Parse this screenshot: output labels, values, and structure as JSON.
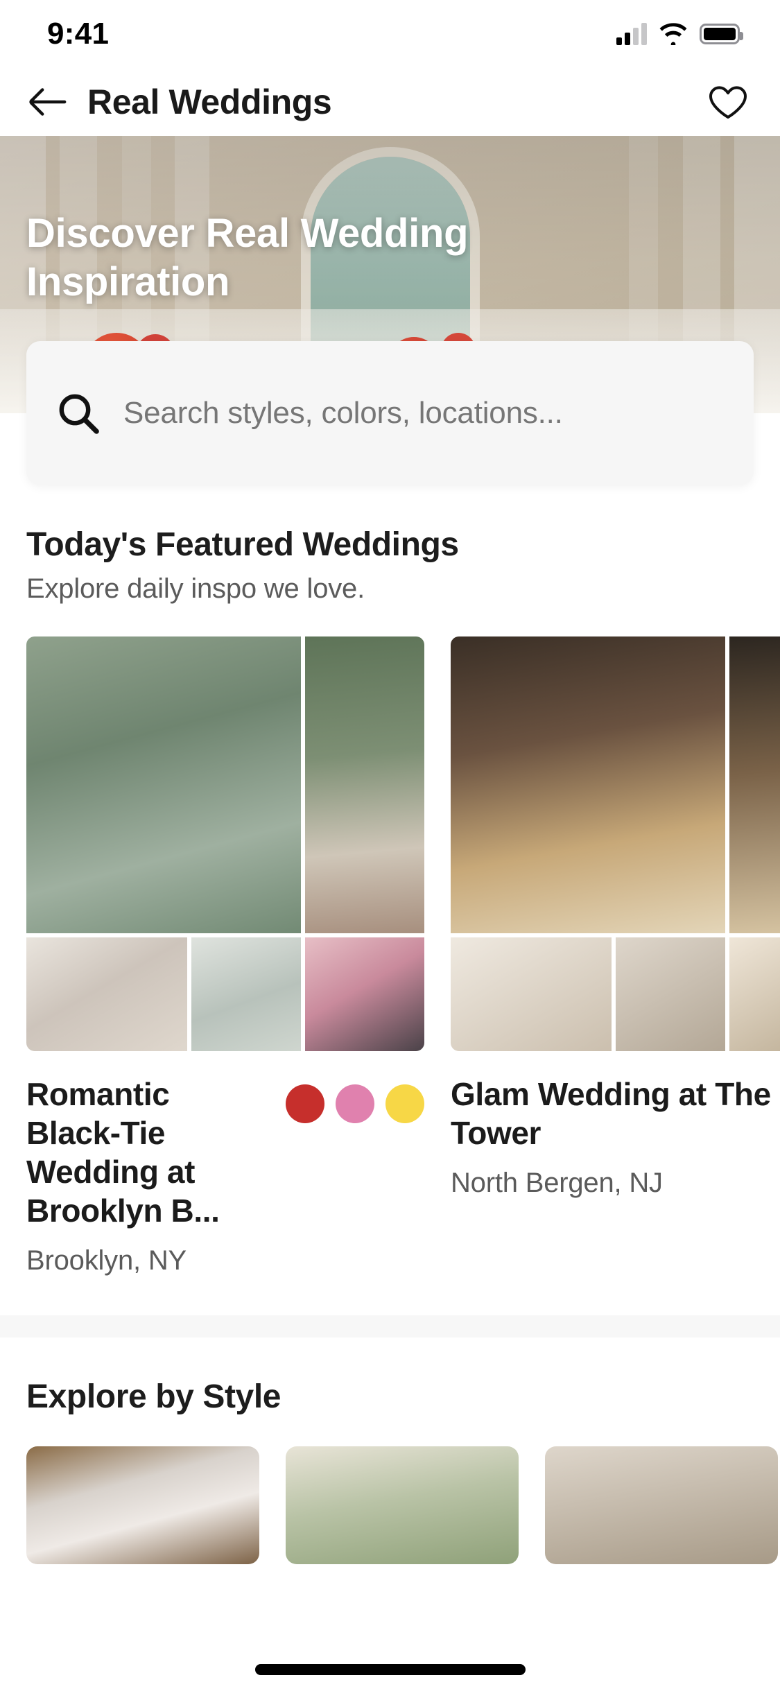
{
  "status_bar": {
    "time": "9:41",
    "signal_icon": "cellular-signal-icon",
    "wifi_icon": "wifi-icon",
    "battery_icon": "battery-icon"
  },
  "nav": {
    "back_icon": "back-arrow-icon",
    "title": "Real Weddings",
    "favorite_icon": "heart-icon"
  },
  "hero": {
    "title": "Discover Real Wedding Inspiration"
  },
  "search": {
    "icon": "search-icon",
    "placeholder": "Search styles, colors, locations...",
    "value": ""
  },
  "featured": {
    "title": "Today's Featured Weddings",
    "subtitle": "Explore daily inspo we love.",
    "cards": [
      {
        "title": "Romantic Black-Tie Wedding at Brooklyn B...",
        "location": "Brooklyn, NY",
        "colors": [
          "#C62F2C",
          "#E081AE",
          "#F7D746"
        ]
      },
      {
        "title": "Glam Wedding at The Tower",
        "title_visible": "Glam",
        "title_visible_2": "The ",
        "location_visible": "North",
        "location": "North Bergen, NJ",
        "colors": []
      }
    ]
  },
  "explore": {
    "title": "Explore by Style"
  },
  "colors": {
    "accent_red": "#C62F2C",
    "accent_pink": "#E081AE",
    "accent_yellow": "#F7D746",
    "search_bg": "#F6F6F6",
    "divider": "#F7F7F7",
    "text_primary": "#1B1B1B",
    "text_secondary": "#5B5B5B"
  }
}
